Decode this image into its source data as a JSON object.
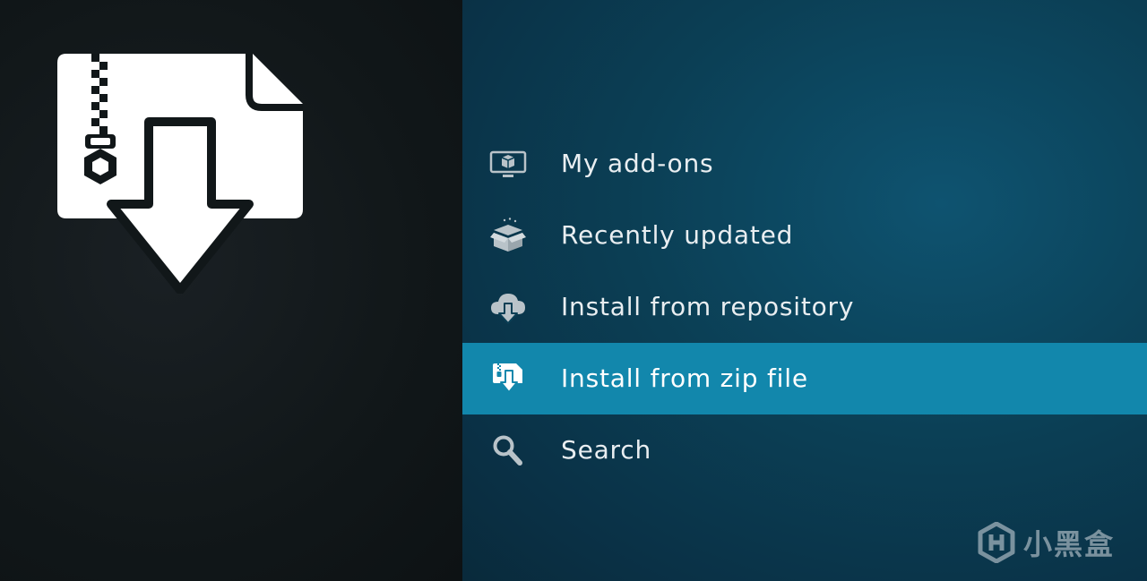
{
  "hero": {
    "icon": "zip-file-download-icon"
  },
  "menu": {
    "items": [
      {
        "label": "My add-ons",
        "icon": "monitor-addon-icon",
        "focused": false
      },
      {
        "label": "Recently updated",
        "icon": "open-box-sparkle-icon",
        "focused": false
      },
      {
        "label": "Install from repository",
        "icon": "cloud-download-icon",
        "focused": false
      },
      {
        "label": "Install from zip file",
        "icon": "zip-file-download-icon",
        "focused": true
      },
      {
        "label": "Search",
        "icon": "magnifier-icon",
        "focused": false
      }
    ]
  },
  "watermark": {
    "text": "小黑盒",
    "icon": "xiaoheihe-logo-icon"
  },
  "colors": {
    "focus_highlight": "#1287ac",
    "right_panel": "#0b3f55",
    "left_panel": "#111719",
    "label_text": "#e9eef1",
    "icon_gray": "#b9c3c9"
  }
}
